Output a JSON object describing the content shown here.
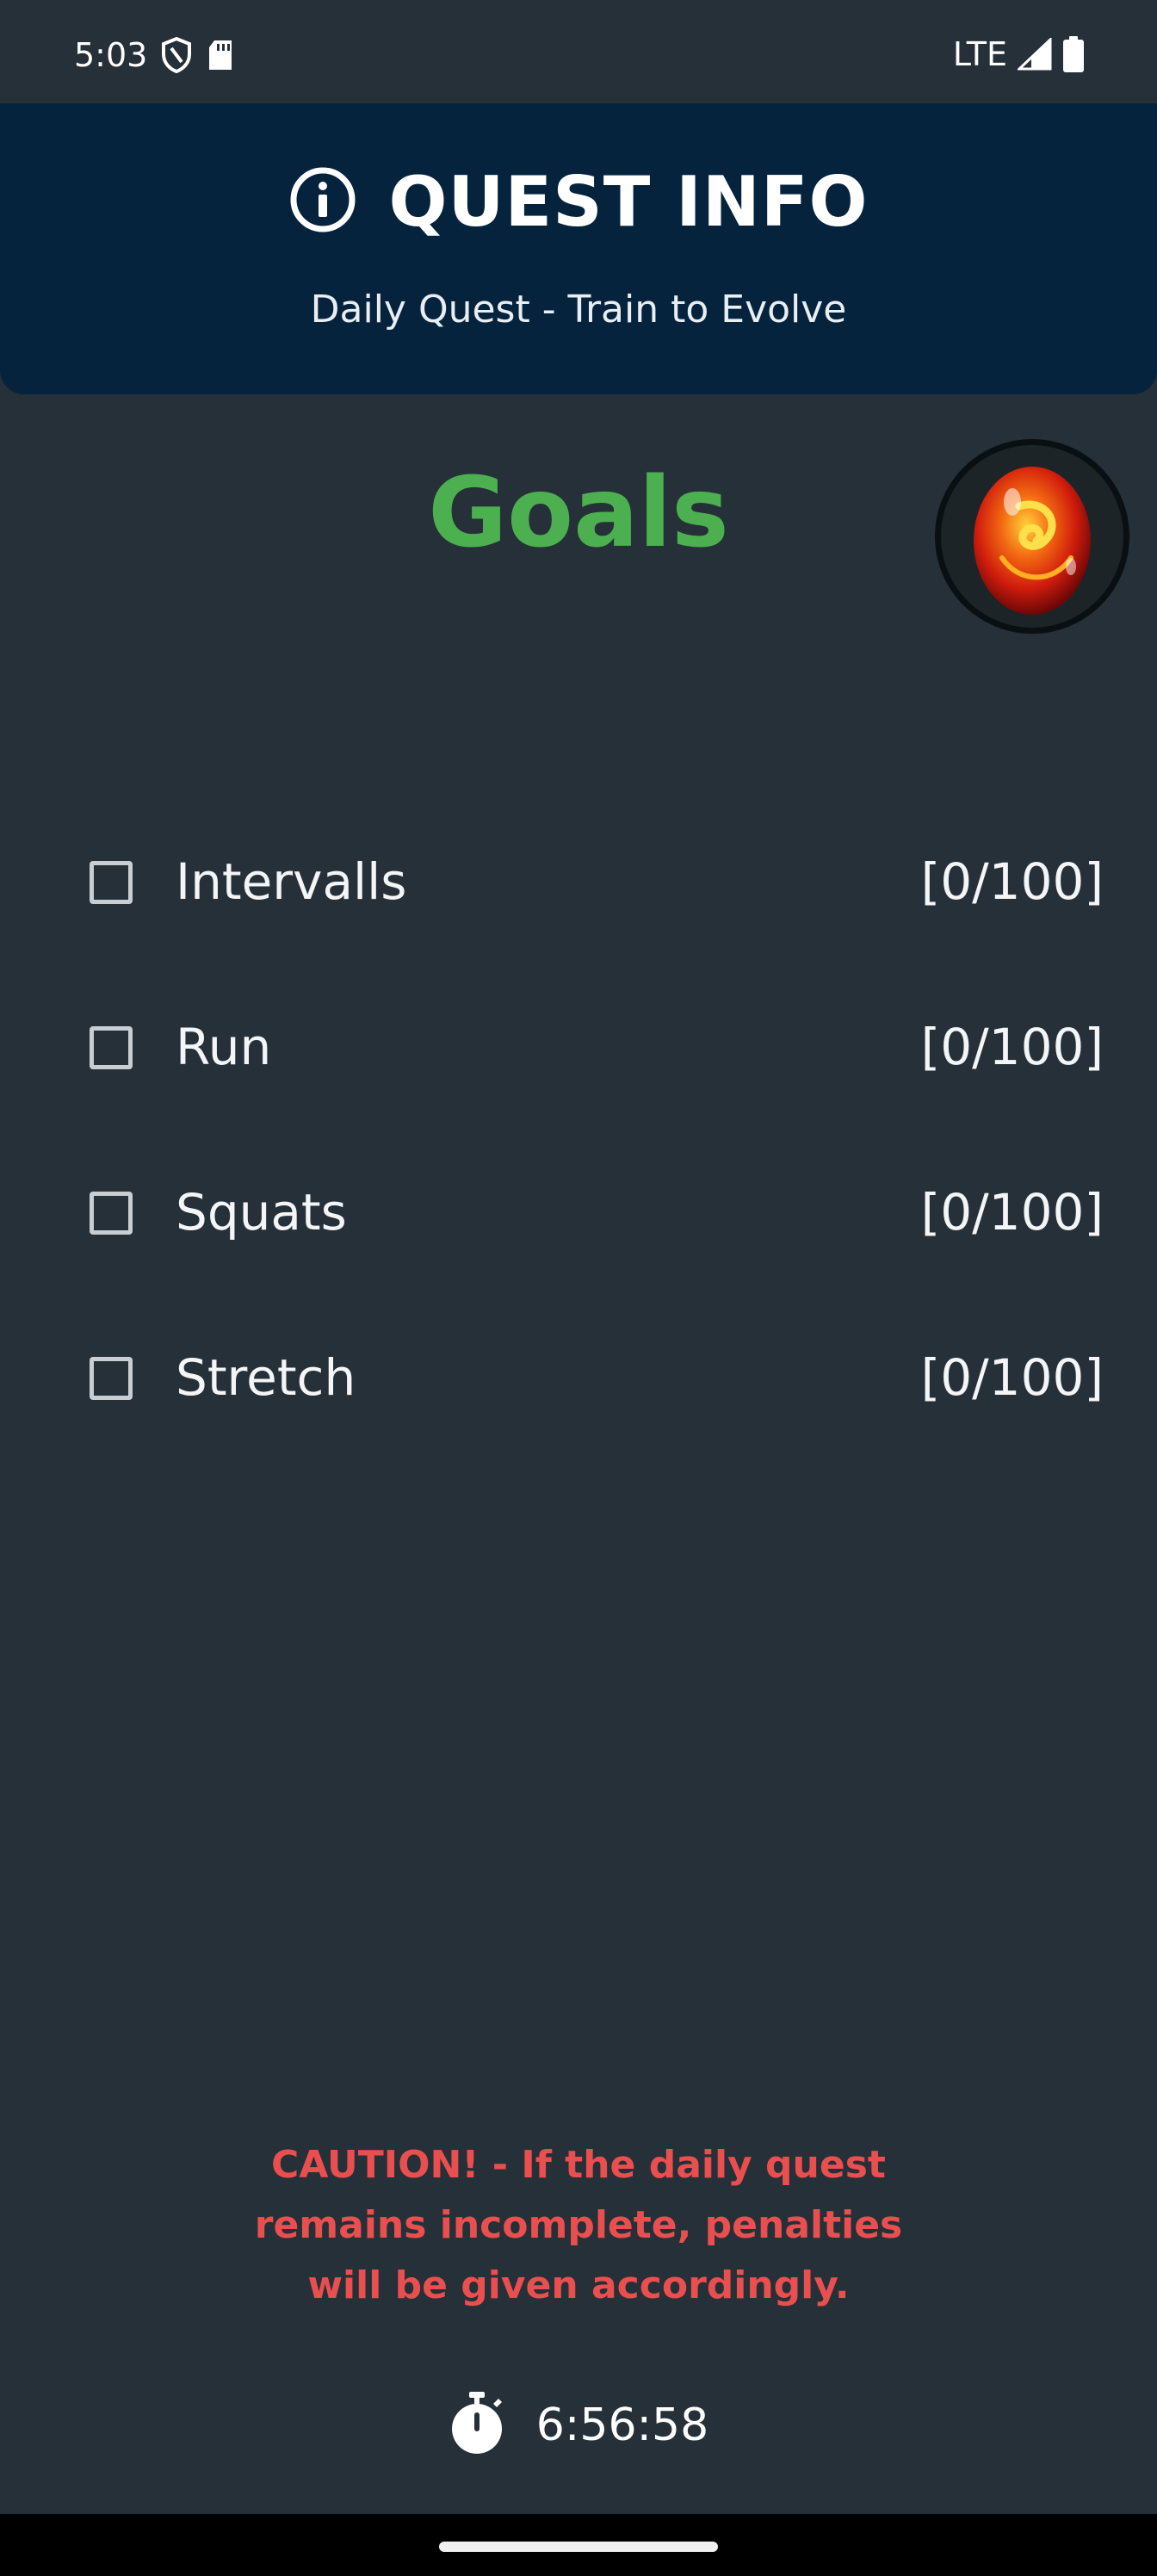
{
  "status_bar": {
    "time": "5:03",
    "network": "LTE",
    "icons": [
      "shield-icon",
      "sd-card-icon",
      "signal-icon",
      "battery-icon"
    ]
  },
  "header": {
    "title": "QUEST INFO",
    "subtitle": "Daily Quest - Train to Evolve",
    "icon": "info-icon"
  },
  "goals": {
    "title": "Goals",
    "avatar": "fire-egg",
    "items": [
      {
        "label": "Intervalls",
        "progress": "[0/100]",
        "checked": false
      },
      {
        "label": "Run",
        "progress": "[0/100]",
        "checked": false
      },
      {
        "label": "Squats",
        "progress": "[0/100]",
        "checked": false
      },
      {
        "label": "Stretch",
        "progress": "[0/100]",
        "checked": false
      }
    ]
  },
  "caution": {
    "line1": "CAUTION! - If the daily quest",
    "line2": "remains incomplete, penalties",
    "line3": "will be given accordingly."
  },
  "timer": {
    "icon": "stopwatch-icon",
    "value": "6:56:58"
  },
  "colors": {
    "background": "#263038",
    "header": "#06233d",
    "goals_title": "#4caf50",
    "caution": "#e94f4f"
  }
}
